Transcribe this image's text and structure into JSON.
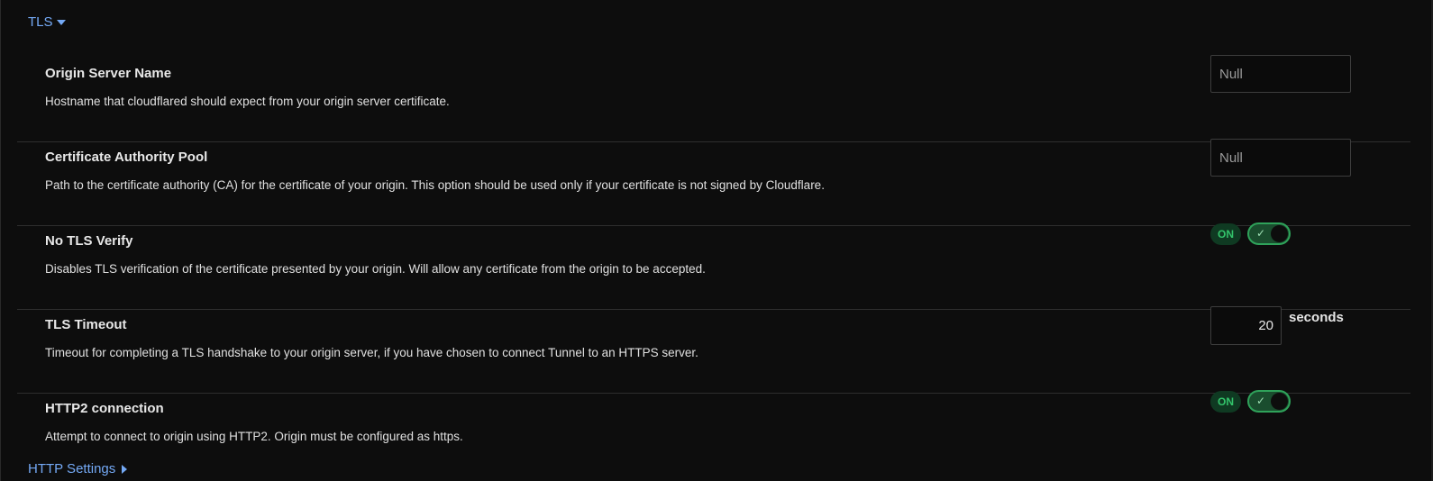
{
  "sections": {
    "tls_label": "TLS",
    "http_label": "HTTP Settings"
  },
  "rows": {
    "origin_server_name": {
      "title": "Origin Server Name",
      "description": "Hostname that cloudflared should expect from your origin server certificate.",
      "placeholder": "Null"
    },
    "ca_pool": {
      "title": "Certificate Authority Pool",
      "description": "Path to the certificate authority (CA) for the certificate of your origin. This option should be used only if your certificate is not signed by Cloudflare.",
      "placeholder": "Null"
    },
    "no_tls_verify": {
      "title": "No TLS Verify",
      "description": "Disables TLS verification of the certificate presented by your origin. Will allow any certificate from the origin to be accepted.",
      "status": "ON",
      "check": "✓"
    },
    "tls_timeout": {
      "title": "TLS Timeout",
      "description": "Timeout for completing a TLS handshake to your origin server, if you have chosen to connect Tunnel to an HTTPS server.",
      "value": "20",
      "unit": "seconds"
    },
    "http2": {
      "title": "HTTP2 connection",
      "description": "Attempt to connect to origin using HTTP2. Origin must be configured as https.",
      "status": "ON",
      "check": "✓"
    }
  },
  "colors": {
    "background": "#0d0d0d",
    "link": "#74a9f5",
    "toggle_on": "#2fa25a"
  },
  "icons": [
    "caret-down-icon",
    "caret-right-icon",
    "check-icon"
  ]
}
